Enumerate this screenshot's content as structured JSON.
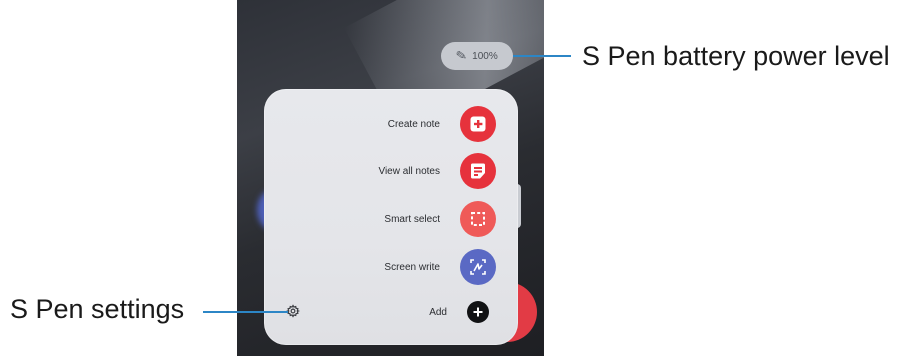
{
  "battery": {
    "percent": "100%"
  },
  "menu": {
    "items": [
      {
        "label": "Create note",
        "icon": "create-note-icon",
        "color": "#e6323c"
      },
      {
        "label": "View all notes",
        "icon": "notes-list-icon",
        "color": "#e6323c"
      },
      {
        "label": "Smart select",
        "icon": "smart-select-icon",
        "color": "#ef5a58"
      },
      {
        "label": "Screen write",
        "icon": "screen-write-icon",
        "color": "#5a69c4"
      },
      {
        "label": "Add",
        "icon": "plus-icon",
        "color": "#111214"
      }
    ],
    "settings_icon": "gear-icon"
  },
  "callouts": {
    "battery": "S Pen battery power level",
    "settings": "S Pen settings"
  },
  "colors": {
    "callout_line": "#2c86c6"
  }
}
